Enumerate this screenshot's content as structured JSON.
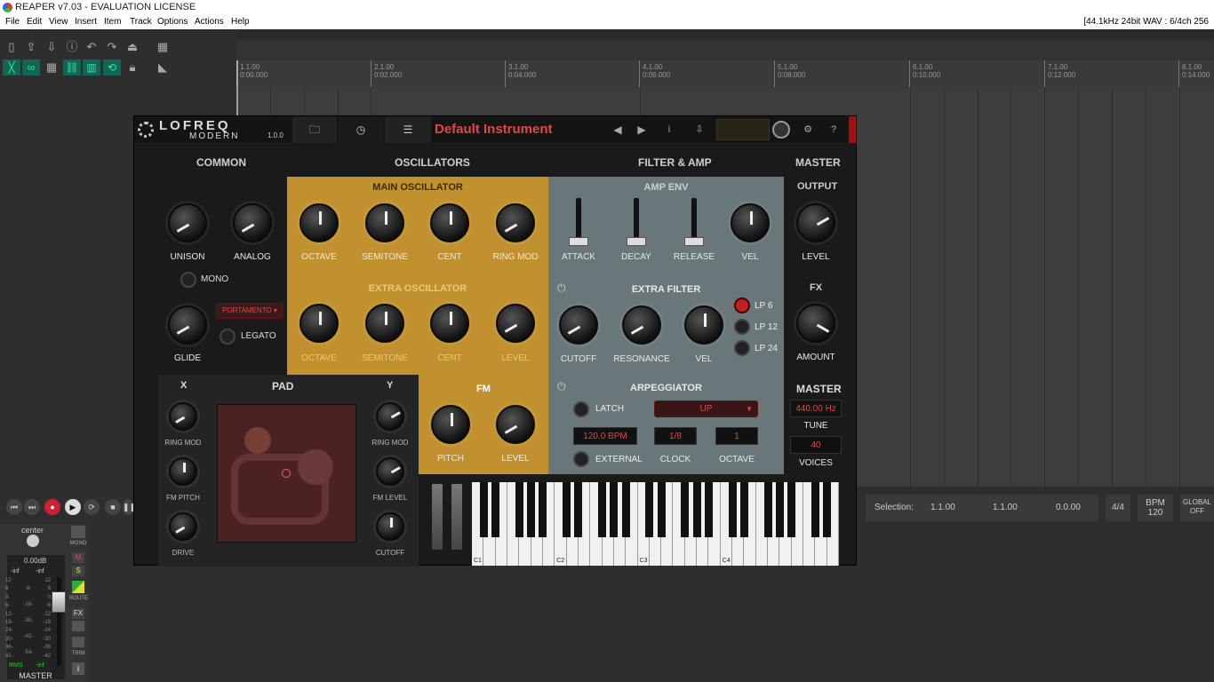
{
  "window": {
    "title": "REAPER v7.03 - EVALUATION LICENSE"
  },
  "menu": [
    "File",
    "Edit",
    "View",
    "Insert",
    "Item",
    "Track",
    "Options",
    "Actions",
    "Help"
  ],
  "format_info": "[44.1kHz 24bit WAV : 6/4ch 256",
  "ruler": [
    {
      "bar": "1.1.00",
      "time": "0:00.000"
    },
    {
      "bar": "2.1.00",
      "time": "0:02.000"
    },
    {
      "bar": "3.1.00",
      "time": "0:04.000"
    },
    {
      "bar": "4.1.00",
      "time": "0:06.000"
    },
    {
      "bar": "5.1.00",
      "time": "0:08.000"
    },
    {
      "bar": "6.1.00",
      "time": "0:10.000"
    },
    {
      "bar": "7.1.00",
      "time": "0:12.000"
    },
    {
      "bar": "8.1.00",
      "time": "0:14.000"
    }
  ],
  "status": {
    "selection_label": "Selection:",
    "start": "1.1.00",
    "end": "1.1.00",
    "length": "0.0.00",
    "timesig": "4/4",
    "bpm_label": "BPM",
    "bpm": "120",
    "global_label": "GLOBAL",
    "global_value": "OFF"
  },
  "mixer": {
    "pan": "center",
    "volume": "0.00dB",
    "peakL": "-inf",
    "peakR": "-inf",
    "rms_label": "RMS",
    "rms_value": "-inf",
    "name": "MASTER",
    "mono": "MONO",
    "m": "M",
    "s": "S",
    "route": "ROUTE",
    "fx": "FX",
    "trim": "TRIM",
    "scaleL": [
      "12",
      "6",
      "0-",
      "6-",
      "12-",
      "18-",
      "24-",
      "30-",
      "36-",
      "42-"
    ],
    "scaleM": [
      "-6-",
      "-18-",
      "-30-",
      "-42-",
      "-54-"
    ],
    "scaleR": [
      "12",
      "6",
      "0",
      "-6",
      "-12",
      "-18",
      "-24",
      "-30",
      "-36",
      "-42"
    ]
  },
  "plugin": {
    "logo_top": "LOFREQ",
    "logo_bottom": "MODERN",
    "version": "1.0.0",
    "preset": "Default Instrument",
    "sections": {
      "common": "COMMON",
      "oscillators": "OSCILLATORS",
      "filter_amp": "FILTER & AMP",
      "master": "MASTER"
    },
    "common": {
      "unison": "UNISON",
      "analog": "ANALOG",
      "mono": "MONO",
      "glide": "GLIDE",
      "portamento": "PORTAMENTO ▾",
      "legato": "LEGATO"
    },
    "main_osc": {
      "title": "MAIN OSCILLATOR",
      "knobs": [
        "OCTAVE",
        "SEMITONE",
        "CENT",
        "RING MOD"
      ]
    },
    "extra_osc": {
      "title": "EXTRA OSCILLATOR",
      "knobs": [
        "OCTAVE",
        "SEMITONE",
        "CENT",
        "LEVEL"
      ]
    },
    "amp_env": {
      "title": "AMP ENV",
      "attack": "ATTACK",
      "decay": "DECAY",
      "release": "RELEASE",
      "vel": "VEL"
    },
    "extra_filter": {
      "title": "EXTRA FILTER",
      "knobs": [
        "CUTOFF",
        "RESONANCE",
        "VEL"
      ],
      "modes": [
        "LP 6",
        "LP 12",
        "LP 24"
      ]
    },
    "arp": {
      "title": "ARPEGGIATOR",
      "latch": "LATCH",
      "mode": "UP",
      "bpm": "120.0 BPM",
      "clock": "1/8",
      "octave": "1",
      "external": "EXTERNAL",
      "clock_label": "CLOCK",
      "octave_label": "OCTAVE"
    },
    "fm": {
      "title": "FM",
      "pitch": "PITCH",
      "level": "LEVEL"
    },
    "pad": {
      "title": "PAD",
      "x": "X",
      "y": "Y",
      "left": [
        "RING MOD",
        "FM PITCH",
        "DRIVE"
      ],
      "right": [
        "RING MOD",
        "FM LEVEL",
        "CUTOFF"
      ]
    },
    "master": {
      "output": "OUTPUT",
      "level": "LEVEL",
      "fx": "FX",
      "amount": "AMOUNT",
      "master": "MASTER",
      "tune_value": "440.00 Hz",
      "tune": "TUNE",
      "voices_value": "40",
      "voices": "VOICES"
    },
    "keys": [
      "C1",
      "C2",
      "C3",
      "C4"
    ]
  }
}
